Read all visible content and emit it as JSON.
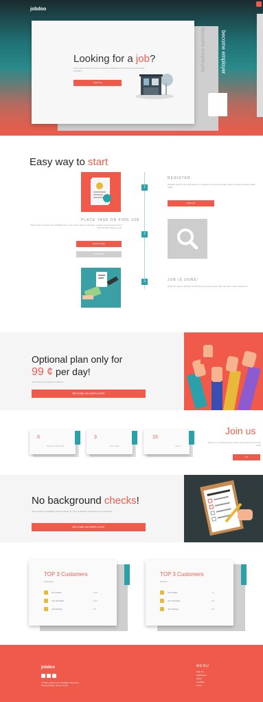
{
  "hero": {
    "logo": "jobdoo",
    "title_prefix": "Looking for a ",
    "title_accent": "job",
    "title_suffix": "?",
    "subtitle": "Lorem ipsum dolor sit amet consectetur adipiscing elit sed do eiusmod tempor incididunt",
    "button": "SIGN UP",
    "card_label": "become employee",
    "back_label": "become employer"
  },
  "easy": {
    "title_prefix": "Easy way to ",
    "title_accent": "start",
    "steps": [
      {
        "num": "1",
        "title": "REGISTER",
        "text": "Register account as a job seeker or employer in just a few simple steps and start browsing offers today.",
        "button": "SIGN UP"
      },
      {
        "num": "2",
        "title": "PLACE TASK OR FIND JOB",
        "text": "Post a task or browse the available jobs in your area. Filter by category, location and payment rate to find the right match for you.",
        "button_primary": "PLACE TASK",
        "button_secondary": "FIND JOB"
      },
      {
        "num": "3",
        "title": "JOB IS DONE!",
        "text": "When the task is finished, confirm the job and get paid. Rate the other side to build trust."
      }
    ]
  },
  "plan": {
    "title_line1": "Optional plan only for",
    "price": "99 ¢",
    "title_line2": " per day!",
    "subtitle": "Get access to all premium features",
    "button": "BECOME AN EMPLOYER"
  },
  "stats": [
    {
      "value": "0",
      "label": "Members last night"
    },
    {
      "value": "3",
      "label": "Jobs done"
    },
    {
      "value": "15",
      "label": "Users"
    }
  ],
  "join": {
    "title": "Join us",
    "text": "Become a member and be part of our growing community today",
    "button": "GO"
  },
  "checks": {
    "title_prefix": "No background ",
    "title_accent": "checks",
    "title_suffix": "!",
    "subtitle": "Start working immediately without waiting for long verification procedures and paperwork.",
    "button": "BECOME AN EMPLOYEE"
  },
  "customers": [
    {
      "title": "TOP 3 Customers",
      "sub": "Employers",
      "rows": [
        {
          "name": "Tom Nolan",
          "value": "12.8"
        },
        {
          "name": "Ann Schwartz",
          "value": "10.4"
        },
        {
          "name": "John Rosen",
          "value": "9.6"
        }
      ]
    },
    {
      "title": "TOP 3 Customers",
      "sub": "Workers",
      "rows": [
        {
          "name": "Tom Nolan",
          "value": "7.1"
        },
        {
          "name": "Ann Schwartz",
          "value": "6.9"
        },
        {
          "name": "John Rosen",
          "value": "6.2"
        }
      ]
    }
  ],
  "footer": {
    "logo": "jobdoo",
    "copy1": "© 2021 Jobdoo LLC. All Rights Reserved.",
    "copy2": "Privacy Policy | Terms of Use",
    "menu_title": "MENU",
    "menu": [
      "Sign Up",
      "Employees",
      "About",
      "Contacts",
      "Terms"
    ]
  },
  "colors": {
    "accent": "#f05a4a",
    "teal": "#2aa0a8"
  }
}
